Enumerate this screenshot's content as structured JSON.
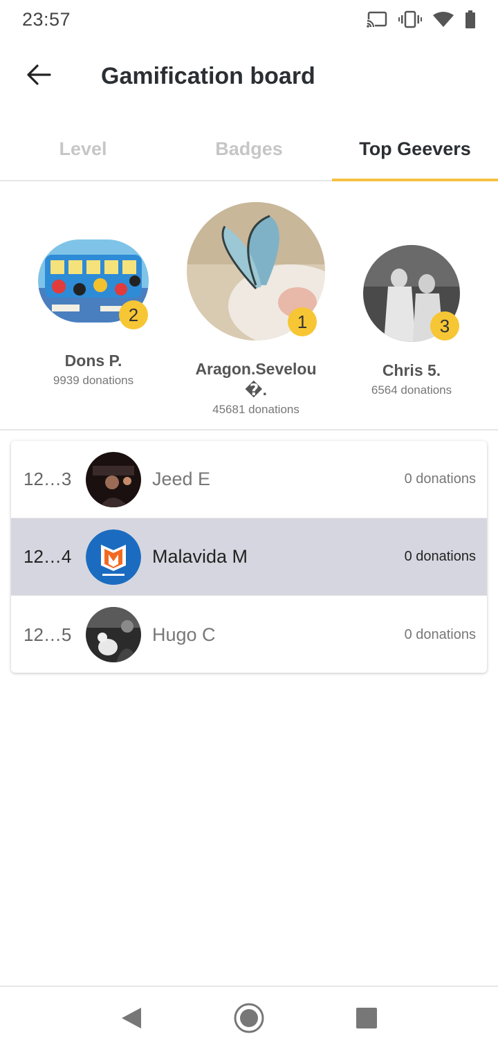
{
  "status_bar": {
    "time": "23:57",
    "icons": [
      "cast-icon",
      "vibrate-icon",
      "wifi-icon",
      "battery-icon"
    ]
  },
  "app_bar": {
    "title": "Gamification board",
    "back_icon": "arrow-left-icon"
  },
  "tabs": [
    {
      "label": "Level",
      "active": false
    },
    {
      "label": "Badges",
      "active": false
    },
    {
      "label": "Top Geevers",
      "active": true
    }
  ],
  "podium": [
    {
      "rank": "2",
      "name": "Dons  P.",
      "donations": "9939 donations"
    },
    {
      "rank": "1",
      "name": "Aragon.Sevelou\n�.",
      "donations": "45681 donations"
    },
    {
      "rank": "3",
      "name": "Chris 5.",
      "donations": "6564 donations"
    }
  ],
  "leaderboard": [
    {
      "position": "12…3",
      "name": "Jeed E",
      "donations": "0 donations",
      "highlight": false
    },
    {
      "position": "12…4",
      "name": "Malavida M",
      "donations": "0 donations",
      "highlight": true
    },
    {
      "position": "12…5",
      "name": "Hugo C",
      "donations": "0 donations",
      "highlight": false
    }
  ],
  "nav_bar": {
    "buttons": [
      "back-triangle-icon",
      "home-circle-icon",
      "recents-square-icon"
    ]
  },
  "colors": {
    "accent": "#f5c242",
    "rank_badge": "#f7c634",
    "highlight_row": "#d6d6e0",
    "malavida_blue": "#1b6cc0",
    "malavida_orange": "#f26a21"
  }
}
